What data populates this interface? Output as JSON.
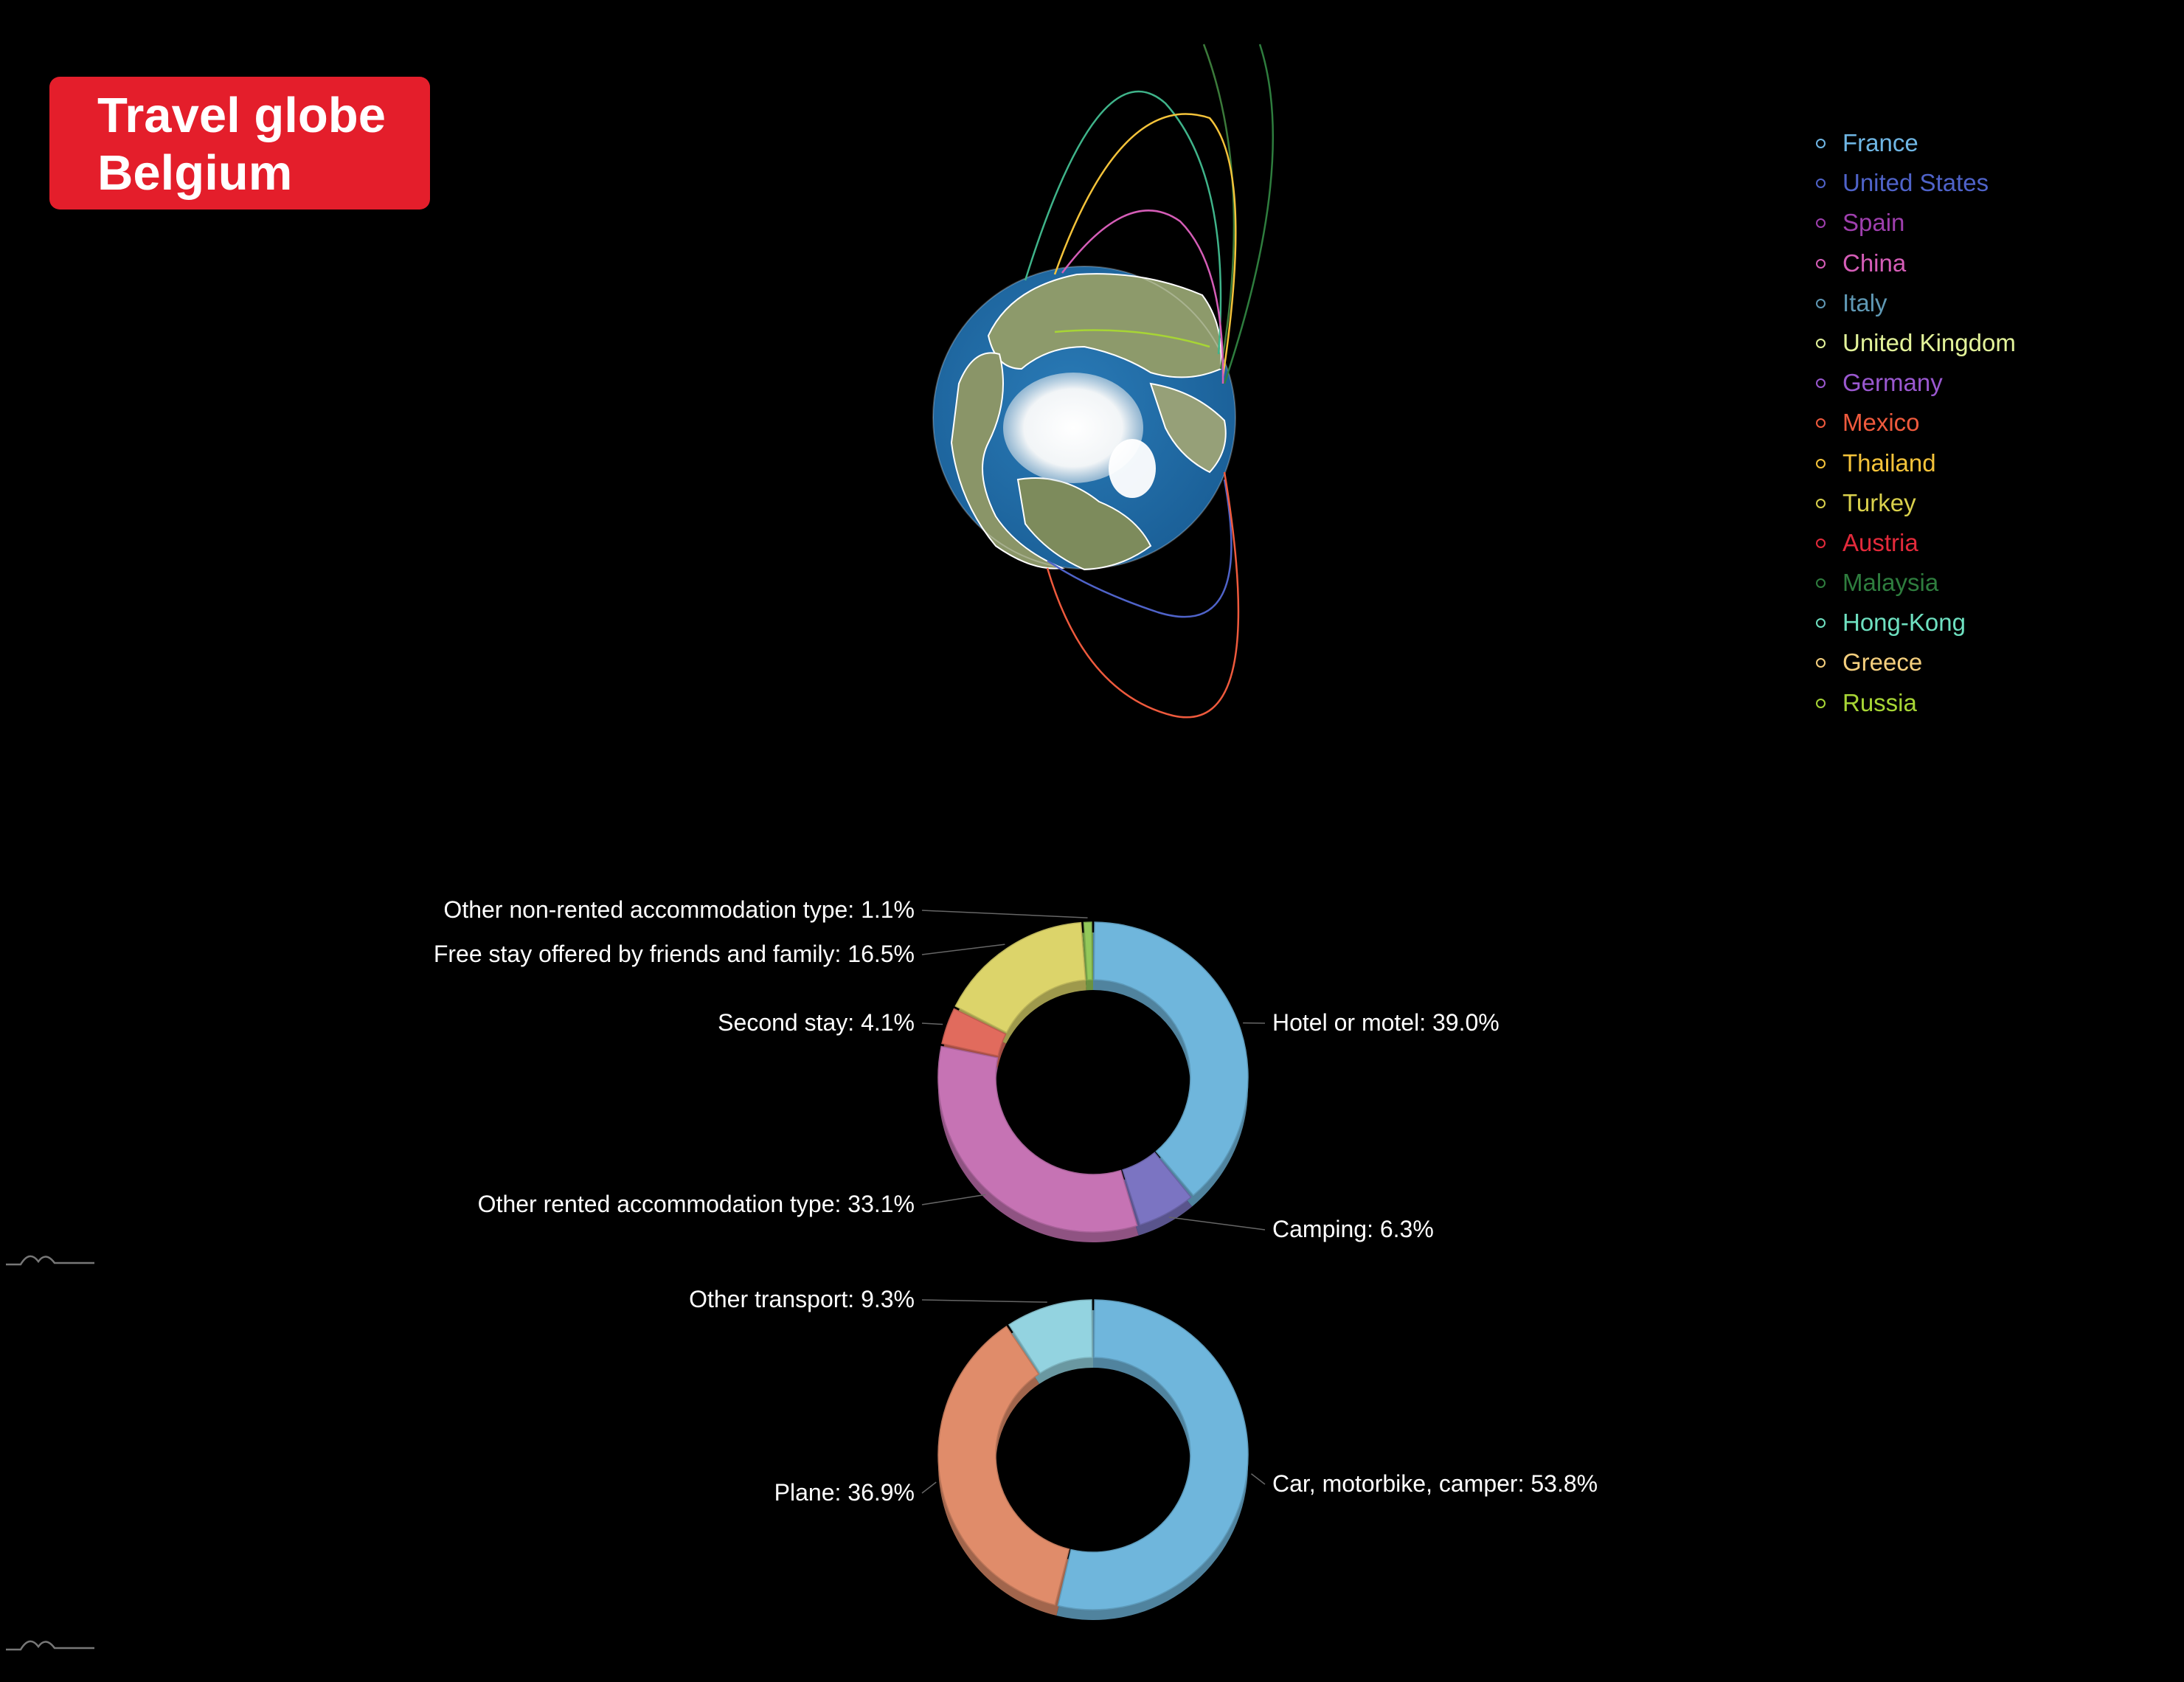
{
  "title": {
    "line1": "Travel globe",
    "line2": "Belgium",
    "bg_color": "#e41e2b"
  },
  "legend": [
    {
      "name": "France",
      "color": "#6fb6e4"
    },
    {
      "name": "United States",
      "color": "#4f63c9"
    },
    {
      "name": "Spain",
      "color": "#9f3fae"
    },
    {
      "name": "China",
      "color": "#d55db7"
    },
    {
      "name": "Italy",
      "color": "#5f98b4"
    },
    {
      "name": "United Kingdom",
      "color": "#e3f39a"
    },
    {
      "name": "Germany",
      "color": "#9a58cf"
    },
    {
      "name": "Mexico",
      "color": "#ef5a3d"
    },
    {
      "name": "Thailand",
      "color": "#f4c33a"
    },
    {
      "name": "Turkey",
      "color": "#d9d04c"
    },
    {
      "name": "Austria",
      "color": "#e32a3b"
    },
    {
      "name": "Malaysia",
      "color": "#2e7d3e"
    },
    {
      "name": "Hong-Kong",
      "color": "#6ee0c0"
    },
    {
      "name": "Greece",
      "color": "#f5cf7e"
    },
    {
      "name": "Russia",
      "color": "#a7d535"
    }
  ],
  "globe": {
    "icon": "earth-globe-icon",
    "ocean_color": "#1f6ca6",
    "routes": [
      {
        "to": "Malaysia",
        "color": "#2e7d3e"
      },
      {
        "to": "Hong-Kong",
        "color": "#3fb48a"
      },
      {
        "to": "Thailand",
        "color": "#f4c33a"
      },
      {
        "to": "China",
        "color": "#d55db7"
      },
      {
        "to": "United States",
        "color": "#4f63c9"
      },
      {
        "to": "Mexico",
        "color": "#ef5a3d"
      }
    ]
  },
  "chart_data": [
    {
      "type": "pie",
      "subtype": "donut",
      "slices": [
        {
          "label": "Hotel or motel",
          "value": 39.0,
          "label_text": "Hotel or motel: 39.0%",
          "color": "#6fb6dc"
        },
        {
          "label": "Camping",
          "value": 6.3,
          "label_text": "Camping: 6.3%",
          "color": "#7b74c2"
        },
        {
          "label": "Other rented accommodation type",
          "value": 33.1,
          "label_text": "Other rented accommodation type: 33.1%",
          "color": "#c673b4"
        },
        {
          "label": "Second stay",
          "value": 4.1,
          "label_text": "Second stay: 4.1%",
          "color": "#e16b5d"
        },
        {
          "label": "Free stay offered by friends and family",
          "value": 16.5,
          "label_text": "Free stay offered by friends and family: 16.5%",
          "color": "#dcd46a"
        },
        {
          "label": "Other non-rented accommodation type",
          "value": 1.1,
          "label_text": "Other non-rented accommodation type: 1.1%",
          "color": "#93c95a"
        }
      ]
    },
    {
      "type": "pie",
      "subtype": "donut",
      "slices": [
        {
          "label": "Car, motorbike, camper",
          "value": 53.8,
          "label_text": "Car, motorbike, camper: 53.8%",
          "color": "#6fb6dc"
        },
        {
          "label": "Plane",
          "value": 36.9,
          "label_text": "Plane: 36.9%",
          "color": "#e08c6a"
        },
        {
          "label": "Other transport",
          "value": 9.3,
          "label_text": "Other transport: 9.3%",
          "color": "#93d3e0"
        }
      ]
    }
  ],
  "chart_icons": [
    "amcharts-logo-icon",
    "amcharts-logo-icon"
  ]
}
